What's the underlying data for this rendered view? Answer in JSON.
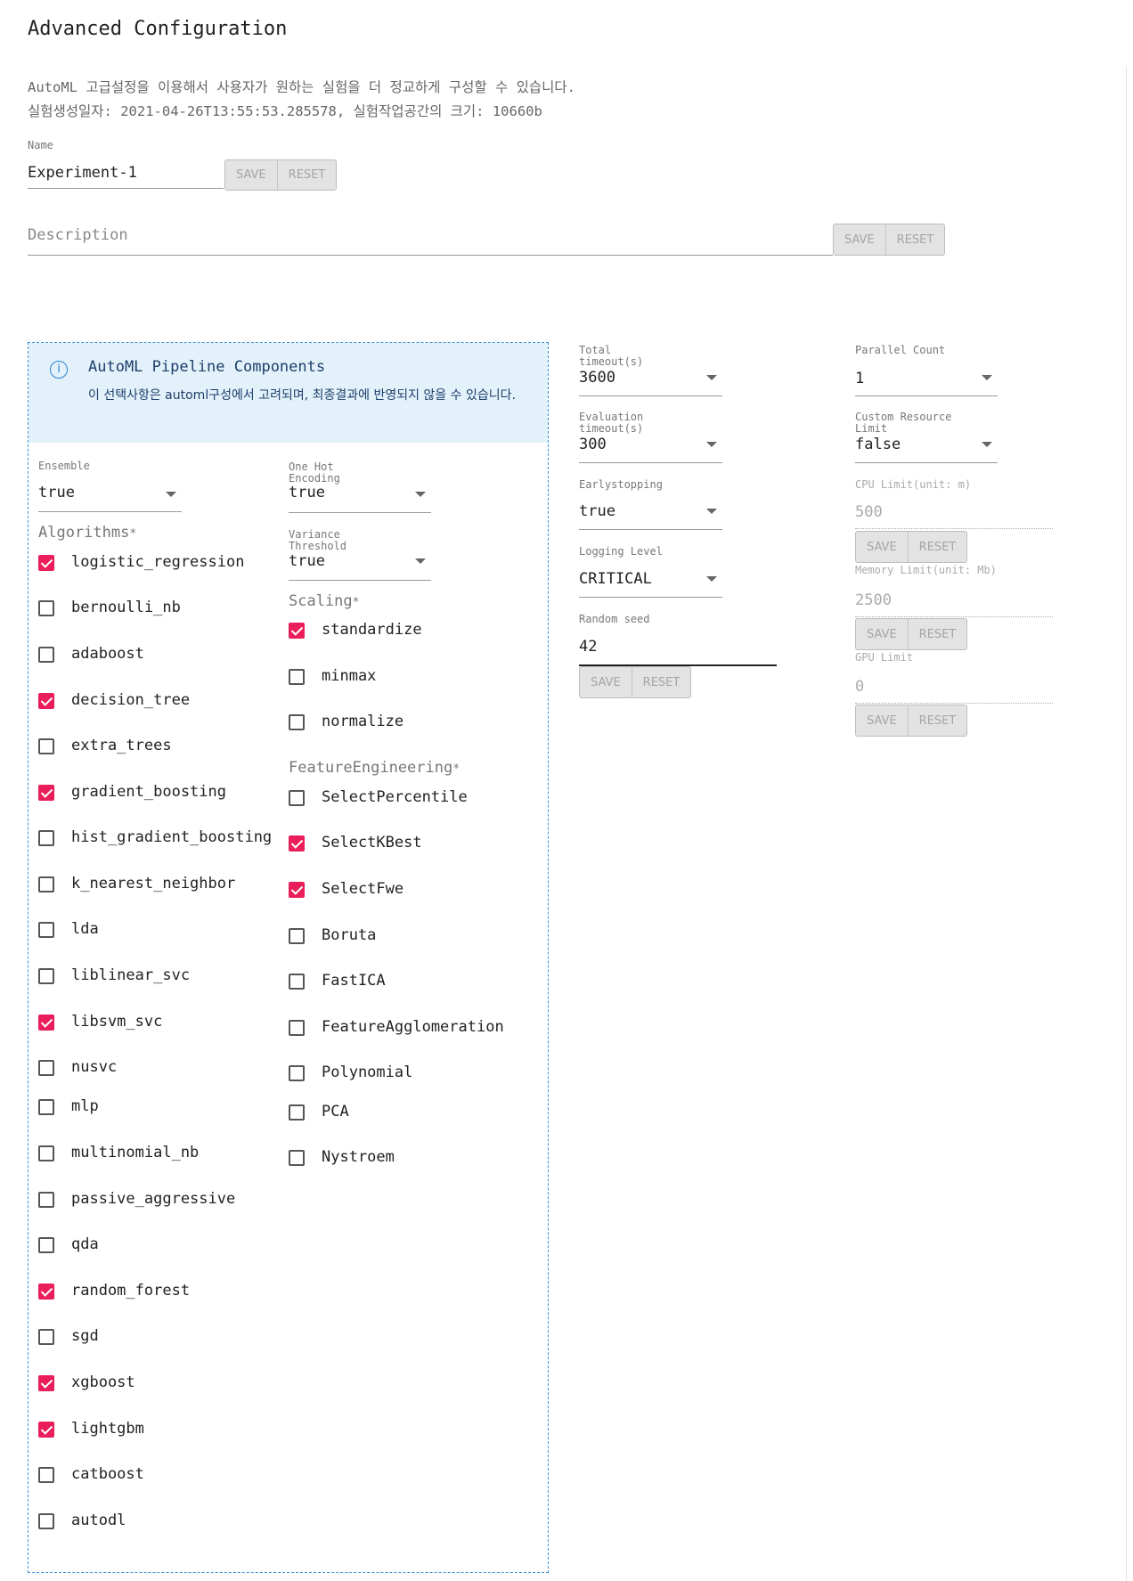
{
  "title": "Advanced Configuration",
  "intro": {
    "line1": "AutoML 고급설정을 이용해서 사용자가 원하는 실험을 더 정교하게 구성할 수 있습니다.",
    "line2": "실험생성일자: 2021-04-26T13:55:53.285578, 실험작업공간의 크기: 10660b"
  },
  "name_field": {
    "label": "Name",
    "value": "Experiment-1",
    "save": "SAVE",
    "reset": "RESET"
  },
  "description_field": {
    "placeholder": "Description",
    "save": "SAVE",
    "reset": "RESET"
  },
  "pipeline": {
    "title": "AutoML Pipeline Components",
    "note": "이 선택사항은 automl구성에서 고려되며, 최종결과에 반영되지 않을 수 있습니다.",
    "ensemble": {
      "label": "Ensemble",
      "value": "true"
    },
    "one_hot": {
      "label": "One Hot Encoding",
      "value": "true"
    },
    "variance": {
      "label": "Variance Threshold",
      "value": "true"
    },
    "algorithms_label": "Algorithms",
    "scaling_label": "Scaling",
    "fe_label": "FeatureEngineering",
    "required_mark": "*",
    "algorithms": [
      {
        "label": "logistic_regression",
        "checked": true
      },
      {
        "label": "bernoulli_nb",
        "checked": false
      },
      {
        "label": "adaboost",
        "checked": false
      },
      {
        "label": "decision_tree",
        "checked": true
      },
      {
        "label": "extra_trees",
        "checked": false
      },
      {
        "label": "gradient_boosting",
        "checked": true
      },
      {
        "label": "hist_gradient_boosting",
        "checked": false
      },
      {
        "label": "k_nearest_neighbor",
        "checked": false
      },
      {
        "label": "lda",
        "checked": false
      },
      {
        "label": "liblinear_svc",
        "checked": false
      },
      {
        "label": "libsvm_svc",
        "checked": true
      },
      {
        "label": "nusvc",
        "checked": false
      },
      {
        "label": "mlp",
        "checked": false
      },
      {
        "label": "multinomial_nb",
        "checked": false
      },
      {
        "label": "passive_aggressive",
        "checked": false
      },
      {
        "label": "qda",
        "checked": false
      },
      {
        "label": "random_forest",
        "checked": true
      },
      {
        "label": "sgd",
        "checked": false
      },
      {
        "label": "xgboost",
        "checked": true
      },
      {
        "label": "lightgbm",
        "checked": true
      },
      {
        "label": "catboost",
        "checked": false
      },
      {
        "label": "autodl",
        "checked": false
      }
    ],
    "scaling": [
      {
        "label": "standardize",
        "checked": true
      },
      {
        "label": "minmax",
        "checked": false
      },
      {
        "label": "normalize",
        "checked": false
      }
    ],
    "feature_engineering": [
      {
        "label": "SelectPercentile",
        "checked": false
      },
      {
        "label": "SelectKBest",
        "checked": true
      },
      {
        "label": "SelectFwe",
        "checked": true
      },
      {
        "label": "Boruta",
        "checked": false
      },
      {
        "label": "FastICA",
        "checked": false
      },
      {
        "label": "FeatureAgglomeration",
        "checked": false
      },
      {
        "label": "Polynomial",
        "checked": false
      },
      {
        "label": "PCA",
        "checked": false
      },
      {
        "label": "Nystroem",
        "checked": false
      }
    ]
  },
  "settings": {
    "total_timeout": {
      "label": "Total timeout(s)",
      "value": "3600"
    },
    "eval_timeout": {
      "label": "Evaluation timeout(s)",
      "value": "300"
    },
    "earlystopping": {
      "label": "Earlystopping",
      "value": "true"
    },
    "logging": {
      "label": "Logging Level",
      "value": "CRITICAL"
    },
    "seed": {
      "label": "Random seed",
      "value": "42",
      "save": "SAVE",
      "reset": "RESET"
    },
    "parallel": {
      "label": "Parallel Count",
      "value": "1"
    },
    "custom_limit": {
      "label": "Custom Resource Limit",
      "value": "false"
    },
    "cpu": {
      "label": "CPU Limit(unit: m)",
      "value": "500",
      "save": "SAVE",
      "reset": "RESET"
    },
    "memory": {
      "label": "Memory Limit(unit: Mb)",
      "value": "2500",
      "save": "SAVE",
      "reset": "RESET"
    },
    "gpu": {
      "label": "GPU Limit",
      "value": "0",
      "save": "SAVE",
      "reset": "RESET"
    }
  }
}
